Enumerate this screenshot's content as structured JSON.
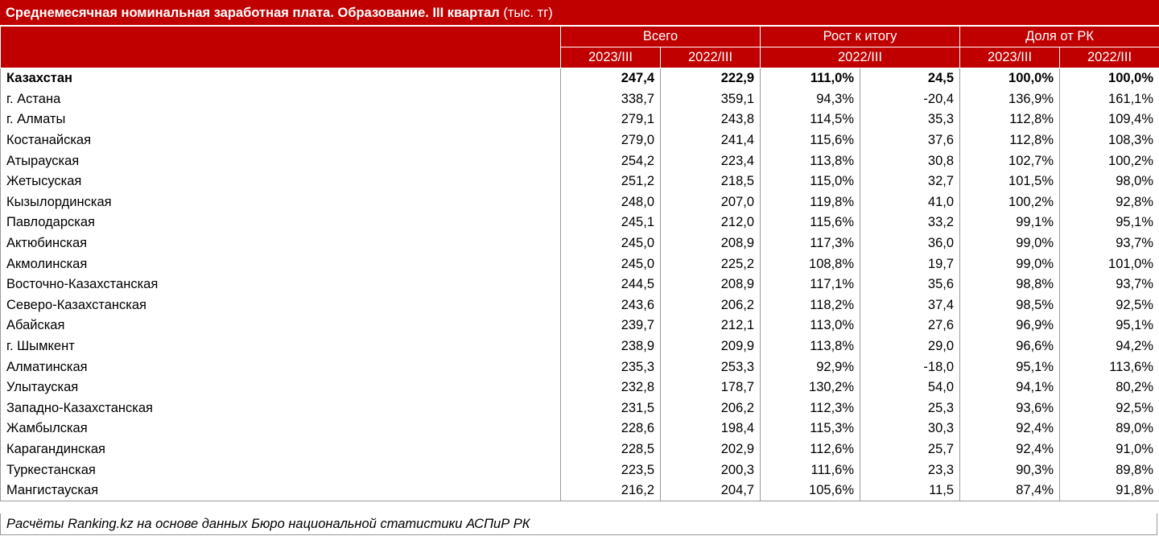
{
  "chart_data": {
    "type": "table",
    "title": "Среднемесячная номинальная заработная плата. Образование. III квартал",
    "unit": "(тыс. тг)",
    "header_groups": [
      "Всего",
      "Рост к итогу",
      "Доля от РК"
    ],
    "subheaders": [
      "2023/III",
      "2022/III",
      "2022/III",
      "2023/III",
      "2022/III"
    ],
    "rows": [
      {
        "region": "Казахстан",
        "total_2023": "247,4",
        "total_2022": "222,9",
        "growth_pct": "111,0%",
        "growth_abs": "24,5",
        "share_2023": "100,0%",
        "share_2022": "100,0%"
      },
      {
        "region": "г. Астана",
        "total_2023": "338,7",
        "total_2022": "359,1",
        "growth_pct": "94,3%",
        "growth_abs": "-20,4",
        "share_2023": "136,9%",
        "share_2022": "161,1%"
      },
      {
        "region": "г. Алматы",
        "total_2023": "279,1",
        "total_2022": "243,8",
        "growth_pct": "114,5%",
        "growth_abs": "35,3",
        "share_2023": "112,8%",
        "share_2022": "109,4%"
      },
      {
        "region": "Костанайская",
        "total_2023": "279,0",
        "total_2022": "241,4",
        "growth_pct": "115,6%",
        "growth_abs": "37,6",
        "share_2023": "112,8%",
        "share_2022": "108,3%"
      },
      {
        "region": "Атырауская",
        "total_2023": "254,2",
        "total_2022": "223,4",
        "growth_pct": "113,8%",
        "growth_abs": "30,8",
        "share_2023": "102,7%",
        "share_2022": "100,2%"
      },
      {
        "region": "Жетысуская",
        "total_2023": "251,2",
        "total_2022": "218,5",
        "growth_pct": "115,0%",
        "growth_abs": "32,7",
        "share_2023": "101,5%",
        "share_2022": "98,0%"
      },
      {
        "region": "Кызылординская",
        "total_2023": "248,0",
        "total_2022": "207,0",
        "growth_pct": "119,8%",
        "growth_abs": "41,0",
        "share_2023": "100,2%",
        "share_2022": "92,8%"
      },
      {
        "region": "Павлодарская",
        "total_2023": "245,1",
        "total_2022": "212,0",
        "growth_pct": "115,6%",
        "growth_abs": "33,2",
        "share_2023": "99,1%",
        "share_2022": "95,1%"
      },
      {
        "region": "Актюбинская",
        "total_2023": "245,0",
        "total_2022": "208,9",
        "growth_pct": "117,3%",
        "growth_abs": "36,0",
        "share_2023": "99,0%",
        "share_2022": "93,7%"
      },
      {
        "region": "Акмолинская",
        "total_2023": "245,0",
        "total_2022": "225,2",
        "growth_pct": "108,8%",
        "growth_abs": "19,7",
        "share_2023": "99,0%",
        "share_2022": "101,0%"
      },
      {
        "region": "Восточно-Казахстанская",
        "total_2023": "244,5",
        "total_2022": "208,9",
        "growth_pct": "117,1%",
        "growth_abs": "35,6",
        "share_2023": "98,8%",
        "share_2022": "93,7%"
      },
      {
        "region": "Северо-Казахстанская",
        "total_2023": "243,6",
        "total_2022": "206,2",
        "growth_pct": "118,2%",
        "growth_abs": "37,4",
        "share_2023": "98,5%",
        "share_2022": "92,5%"
      },
      {
        "region": "Абайская",
        "total_2023": "239,7",
        "total_2022": "212,1",
        "growth_pct": "113,0%",
        "growth_abs": "27,6",
        "share_2023": "96,9%",
        "share_2022": "95,1%"
      },
      {
        "region": "г. Шымкент",
        "total_2023": "238,9",
        "total_2022": "209,9",
        "growth_pct": "113,8%",
        "growth_abs": "29,0",
        "share_2023": "96,6%",
        "share_2022": "94,2%"
      },
      {
        "region": "Алматинская",
        "total_2023": "235,3",
        "total_2022": "253,3",
        "growth_pct": "92,9%",
        "growth_abs": "-18,0",
        "share_2023": "95,1%",
        "share_2022": "113,6%"
      },
      {
        "region": "Улытауская",
        "total_2023": "232,8",
        "total_2022": "178,7",
        "growth_pct": "130,2%",
        "growth_abs": "54,0",
        "share_2023": "94,1%",
        "share_2022": "80,2%"
      },
      {
        "region": "Западно-Казахстанская",
        "total_2023": "231,5",
        "total_2022": "206,2",
        "growth_pct": "112,3%",
        "growth_abs": "25,3",
        "share_2023": "93,6%",
        "share_2022": "92,5%"
      },
      {
        "region": "Жамбылская",
        "total_2023": "228,6",
        "total_2022": "198,4",
        "growth_pct": "115,3%",
        "growth_abs": "30,3",
        "share_2023": "92,4%",
        "share_2022": "89,0%"
      },
      {
        "region": "Карагандинская",
        "total_2023": "228,5",
        "total_2022": "202,9",
        "growth_pct": "112,6%",
        "growth_abs": "25,7",
        "share_2023": "92,4%",
        "share_2022": "91,0%"
      },
      {
        "region": "Туркестанская",
        "total_2023": "223,5",
        "total_2022": "200,3",
        "growth_pct": "111,6%",
        "growth_abs": "23,3",
        "share_2023": "90,3%",
        "share_2022": "89,8%"
      },
      {
        "region": "Мангистауская",
        "total_2023": "216,2",
        "total_2022": "204,7",
        "growth_pct": "105,6%",
        "growth_abs": "11,5",
        "share_2023": "87,4%",
        "share_2022": "91,8%"
      }
    ],
    "source": "Расчёты Ranking.kz на основе данных Бюро национальной статистики АСПиР РК",
    "colors": {
      "header_bg": "#c00000",
      "header_text": "#ffffff",
      "grid": "#9a9a9a"
    }
  }
}
